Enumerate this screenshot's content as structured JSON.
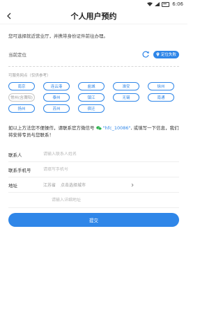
{
  "status_bar": {
    "time": "6:06"
  },
  "header": {
    "title": "个人用户预约"
  },
  "intro": {
    "text": "您可选择就近营业厅，并携带身份证件前往办理。"
  },
  "location": {
    "label": "当前定位",
    "fail_label": "定位失败"
  },
  "cities_section": {
    "hint": "可服务网点（仅供参考）",
    "items": [
      {
        "label": "南京",
        "enabled": true
      },
      {
        "label": "连云港",
        "enabled": true
      },
      {
        "label": "盐城",
        "enabled": true
      },
      {
        "label": "淮安",
        "enabled": true
      },
      {
        "label": "徐州",
        "enabled": true
      },
      {
        "label": "常州(含溧阳)",
        "enabled": false
      },
      {
        "label": "泰州",
        "enabled": true
      },
      {
        "label": "镇江",
        "enabled": true
      },
      {
        "label": "无锡",
        "enabled": true
      },
      {
        "label": "南通",
        "enabled": true
      },
      {
        "label": "扬州",
        "enabled": true
      },
      {
        "label": "苏州",
        "enabled": true
      },
      {
        "label": "宿迁",
        "enabled": true
      }
    ]
  },
  "wechat_note": {
    "prefix": "如以上方法您不便操作，请联系官方微信号",
    "wechat_id": "\"hfc_10086\"",
    "suffix": ", 或填写一下信息，我们将安排专员与您联系！"
  },
  "form": {
    "contact_label": "联系人",
    "contact_placeholder": "请输入联系人姓名",
    "phone_label": "联系手机号",
    "phone_placeholder": "请填写手机号",
    "address_label": "地址",
    "province": "江苏省",
    "city_placeholder": "点击选择城市",
    "detail_placeholder": "请输入详细地址"
  },
  "submit": {
    "label": "提交"
  },
  "colors": {
    "accent": "#2f86e8",
    "wechat": "#2bb24c"
  }
}
